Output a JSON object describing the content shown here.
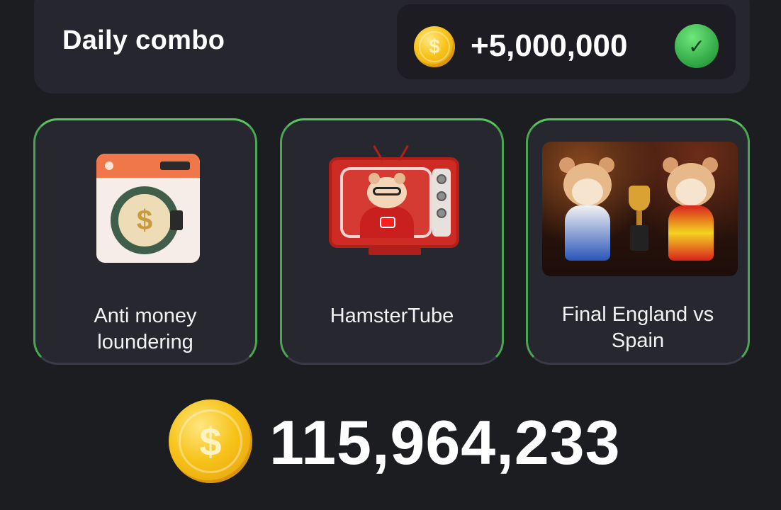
{
  "daily_combo": {
    "title": "Daily combo",
    "reward_amount": "+5,000,000",
    "completed": true
  },
  "cards": [
    {
      "label": "Anti money loundering",
      "icon": "washing-machine-icon",
      "selected": true
    },
    {
      "label": "HamsterTube",
      "icon": "hamster-tv-icon",
      "selected": true
    },
    {
      "label": "Final England vs Spain",
      "icon": "hamster-match-image",
      "selected": true
    }
  ],
  "balance": {
    "amount": "115,964,233",
    "icon": "coin-icon"
  },
  "colors": {
    "background": "#1b1d20",
    "panel": "#26262f",
    "card_border_selected": "#58c55f",
    "coin_gold": "#f7c31a",
    "check_green": "#2ea443"
  }
}
